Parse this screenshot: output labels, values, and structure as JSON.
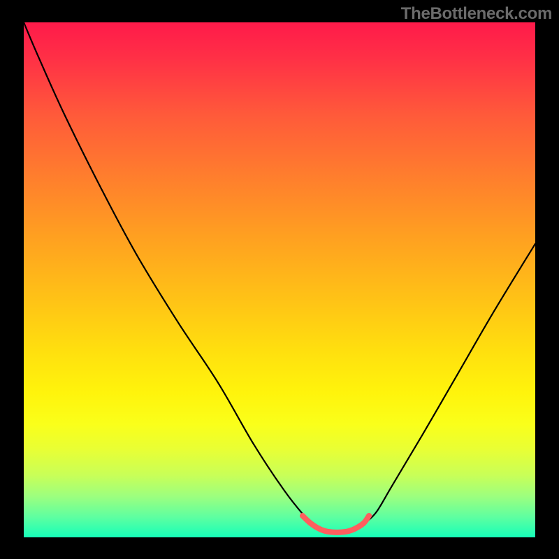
{
  "watermark": "TheBottleneck.com",
  "chart_data": {
    "type": "line",
    "title": "",
    "xlabel": "",
    "ylabel": "",
    "xlim": [
      0,
      100
    ],
    "ylim": [
      0,
      100
    ],
    "grid": false,
    "series": [
      {
        "name": "curve",
        "color": "#000000",
        "x": [
          0,
          3,
          8,
          15,
          22,
          30,
          38,
          45,
          51,
          55,
          57,
          59,
          60,
          62,
          64,
          66,
          67,
          69,
          72,
          78,
          85,
          92,
          100
        ],
        "y": [
          100,
          93,
          82,
          68,
          55,
          42,
          30,
          18,
          9,
          4,
          2,
          1.2,
          1,
          1,
          1.2,
          2,
          3,
          5,
          10,
          20,
          32,
          44,
          57
        ]
      },
      {
        "name": "highlight",
        "color": "#ff5e5e",
        "x": [
          54.5,
          56,
          57.5,
          59,
          60.5,
          62,
          63.5,
          65,
          66.5,
          67.5
        ],
        "y": [
          4.2,
          2.8,
          1.8,
          1.2,
          1.0,
          1.0,
          1.2,
          1.8,
          2.8,
          4.2
        ]
      }
    ]
  },
  "colors": {
    "background_black": "#000000",
    "watermark_text": "#6b6b6b",
    "gradient_top": "#ff1a4a",
    "gradient_bottom": "#16ffb9",
    "curve_stroke": "#000000",
    "highlight_stroke": "#ff5e5e"
  }
}
